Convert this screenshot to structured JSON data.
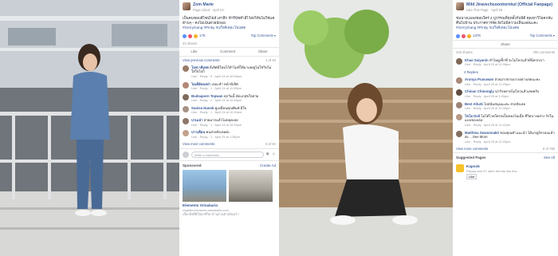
{
  "post1": {
    "page_name": "Zom Marie",
    "meta": "Page Liked · April 24 ·",
    "text": "เป็นคนชอบดีไซน์โยส์ เสาทึก ฟ้ารีนัชทำอีไว้ส่งให้นไม่ใช่แค่ด้านๆ-- คงไม่เน้นด่วยนักออ",
    "hashtags": "#GerryGang #Pinky #แก๊งค์เดอะไม่แตด",
    "reaction_count": "17K",
    "top_comments": "Top Comments ▾",
    "shares": "44 shares",
    "like": "Like",
    "comment": "Comment",
    "share": "Share",
    "prev_comments": "View previous comments",
    "prev_count": "1 of 84",
    "comments": [
      {
        "name": "โอฟ กติเทพ",
        "text": "ดีเลิศมิใหม่ไว้ทำไมที่ให้มาเลยดูไม่ใช่วิปไม่ใส่ใจไปก็",
        "meta": "Like · Reply · 5 · April 24 at 10:56pm"
      },
      {
        "name": "ไอเดีย์ทองท่า",
        "text": "เลอะทำ หน้าดีเลิศ",
        "meta": "Like · Reply · 1 · April 24 at 11:09pm"
      },
      {
        "name": "Budsaporn Tepwan",
        "text": "ทุกวันนี้ บัดแกสุขใจสวย",
        "meta": "Like · Reply · 2 · April 24 at 10:46pm"
      },
      {
        "name": "Sunisa Hanok",
        "text": "ดูเหมือนคุณพิมพ์ มิใจ",
        "meta": "Like · Reply · 1 · April 24 at 10:30pm"
      },
      {
        "name": "ปาเมล่า",
        "text": "สวยมากแล้วไม่หยุดเลย",
        "meta": "Like · Reply · 1 · April 24 at 10:30pm"
      },
      {
        "name": "ปาวเดือน",
        "text": "คนสวยจังเลยค่ะ",
        "meta": "Like · Reply · 1 · April 25 at 1:38pm"
      }
    ],
    "view_more": "View more comments",
    "view_more_count": "6 of 84",
    "write_placeholder": "Write a comment...",
    "sponsored": "Sponsored",
    "create_ad": "Create Ad",
    "ad_name": "Elements Srinakarin",
    "ad_url": "register.elements-srinakarin.com",
    "ad_desc": "เลือกสิ่งที่ดีให้แก่ชีวิต บ้านส่วนตัวพร้อมวิว"
  },
  "post2": {
    "page_name": "Mild Jiravechsoontornkul (Official Fanpage)",
    "meta": "Like This Page · April 25 ·",
    "text": "ชมนางแมลงชอบใคร่ 2 ปูวรรณที่ทุกตั้งกับพีดี คุณขาวิโยคกลับคืนไปบ้าน ประกาศการจัด ยังไม่มีความเห็นเลยนะคะ",
    "hashtags": "#GerryGang #Pinky #แก๊งค์เดอะไม่แตด",
    "reaction_count": "137K",
    "top_comments": "Top Comments ▾",
    "share": "Share",
    "shares": "432 shares",
    "comments_count": "785 comments",
    "comments": [
      {
        "name": "Khao Saiyanin",
        "text": "ทำไมดูเซ็กซี่ จะไม่ไหวแล้วที่นี่พวกเรา",
        "meta": "Like · Reply · April 25 at 12:08pm"
      },
      {
        "name": "",
        "text": "4 Replies",
        "meta": ""
      },
      {
        "name": "Arunya Prasuwan",
        "text": "สวยมากตามบางอย่างเลยนะคะ",
        "meta": "Like · Reply · April 25 at 12:25pm"
      },
      {
        "name": "Chinan Chinongly",
        "text": "น่ารักหลายไม่ไหวแล้วเลยครับ",
        "meta": "Like · Reply · April 26 at 1:09pm"
      },
      {
        "name": "Best Alturk",
        "text": "ไปสนับสนุนนะคะ สวยจังเลย",
        "meta": "Like · Reply · April 25 at 10:30pm"
      },
      {
        "name": "ไชโย Doil",
        "text": "ไม่ได้ไวดใครจเป็นของไม่เมื่อ ชีวิตบางอย่าง รักในแบบของเธอ",
        "meta": "Like · Reply · April 26 at 11:42pm"
      },
      {
        "name": "Matthina Suwonnakit",
        "text": "ขอบคุณคำแนะนำ ได้มาดูอีกรอบแล้วค่ะ ...See More",
        "meta": "Like · Reply · April 25 at 12:25pm"
      }
    ],
    "view_more": "View more comments",
    "view_more_count": "6 of 785",
    "suggested": "Suggested Pages",
    "see_all": "See All",
    "kap_name": "Kapook",
    "kap_sub": "Pisppa and 97 other friends like this",
    "kap_like": "Like"
  },
  "colors": {
    "fb_blue": "#385898",
    "like_blue": "#5890ff",
    "love_red": "#f25268",
    "haha": "#f7b125"
  }
}
